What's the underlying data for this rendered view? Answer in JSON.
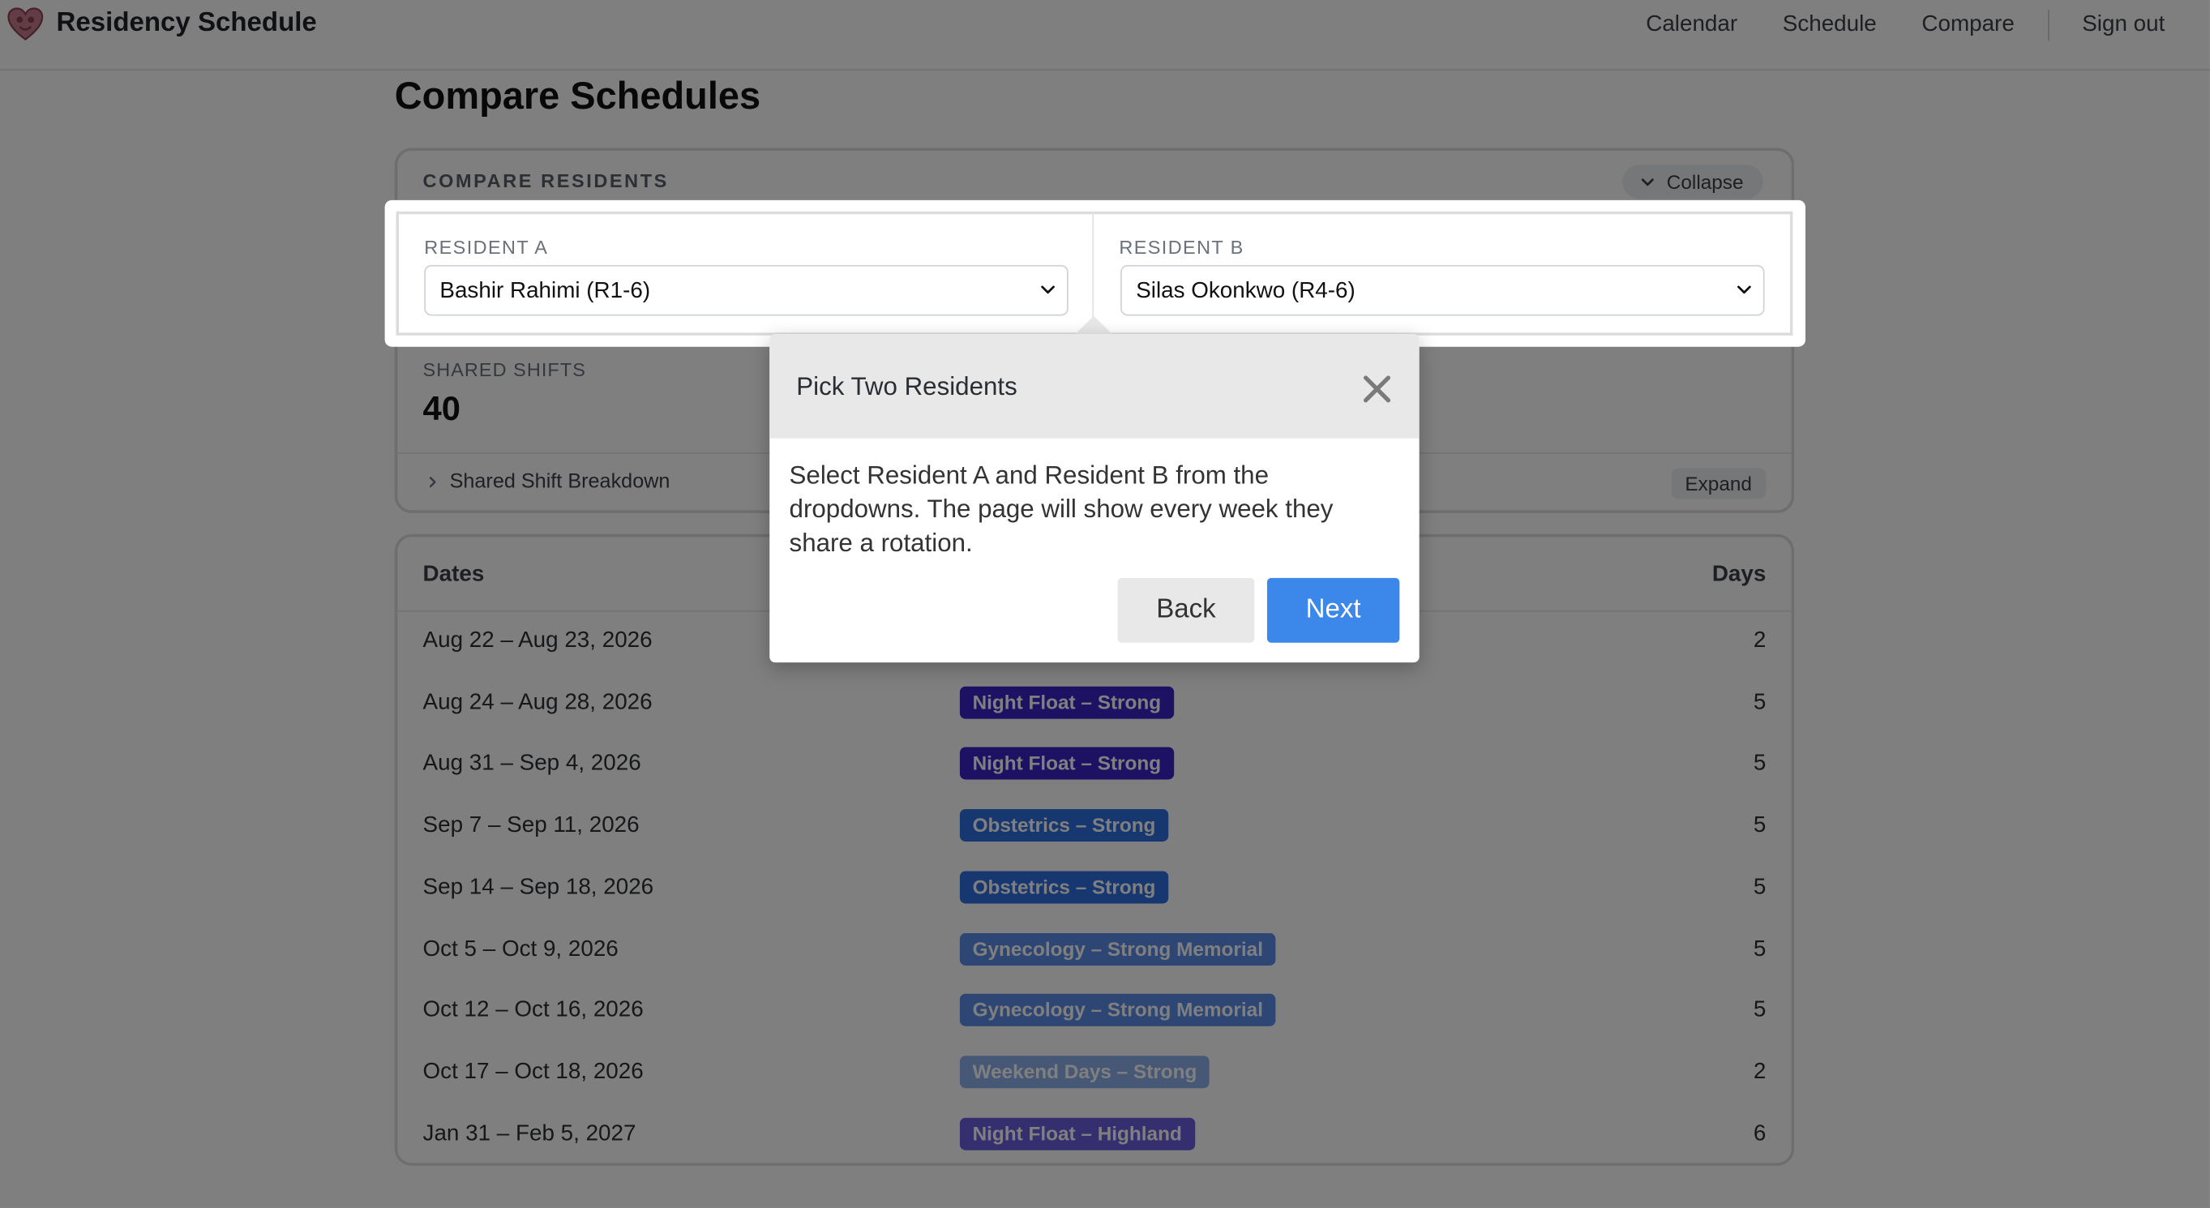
{
  "app": {
    "title": "Residency Schedule",
    "logo_icon": "heart-pelvis-logo-icon"
  },
  "nav": {
    "items": [
      {
        "label": "Calendar"
      },
      {
        "label": "Schedule"
      },
      {
        "label": "Compare"
      }
    ],
    "signout_label": "Sign out"
  },
  "page": {
    "title": "Compare Schedules"
  },
  "compare": {
    "header": "COMPARE RESIDENTS",
    "collapse_label": "Collapse",
    "resident_a": {
      "label": "RESIDENT A",
      "selected": "Bashir Rahimi (R1-6)"
    },
    "resident_b": {
      "label": "RESIDENT B",
      "selected": "Silas Okonkwo (R4-6)"
    },
    "shared_label": "SHARED SHIFTS",
    "shared_value": "40",
    "breakdown_label": "Shared Shift Breakdown",
    "expand_label": "Expand"
  },
  "table": {
    "headers": {
      "dates": "Dates",
      "days": "Days"
    },
    "rows": [
      {
        "dates": "Aug 22 – Aug 23, 2026",
        "rotation": "",
        "color": "#5a6fd6",
        "days": "2"
      },
      {
        "dates": "Aug 24 – Aug 28, 2026",
        "rotation": "Night Float – Strong",
        "color": "#3a22c8",
        "days": "5"
      },
      {
        "dates": "Aug 31 – Sep 4, 2026",
        "rotation": "Night Float – Strong",
        "color": "#3a22c8",
        "days": "5"
      },
      {
        "dates": "Sep 7 – Sep 11, 2026",
        "rotation": "Obstetrics – Strong",
        "color": "#2f6ee3",
        "days": "5"
      },
      {
        "dates": "Sep 14 – Sep 18, 2026",
        "rotation": "Obstetrics – Strong",
        "color": "#2f6ee3",
        "days": "5"
      },
      {
        "dates": "Oct 5 – Oct 9, 2026",
        "rotation": "Gynecology – Strong Memorial",
        "color": "#5b8de8",
        "days": "5"
      },
      {
        "dates": "Oct 12 – Oct 16, 2026",
        "rotation": "Gynecology – Strong Memorial",
        "color": "#5b8de8",
        "days": "5"
      },
      {
        "dates": "Oct 17 – Oct 18, 2026",
        "rotation": "Weekend Days – Strong",
        "color": "#8fb0ef",
        "days": "2"
      },
      {
        "dates": "Jan 31 – Feb 5, 2027",
        "rotation": "Night Float – Highland",
        "color": "#6a5fe0",
        "days": "6"
      }
    ]
  },
  "tour": {
    "title": "Pick Two Residents",
    "body": "Select Resident A and Resident B from the dropdowns. The page will show every week they share a rotation.",
    "back_label": "Back",
    "next_label": "Next",
    "accent": "#3c87ea"
  }
}
